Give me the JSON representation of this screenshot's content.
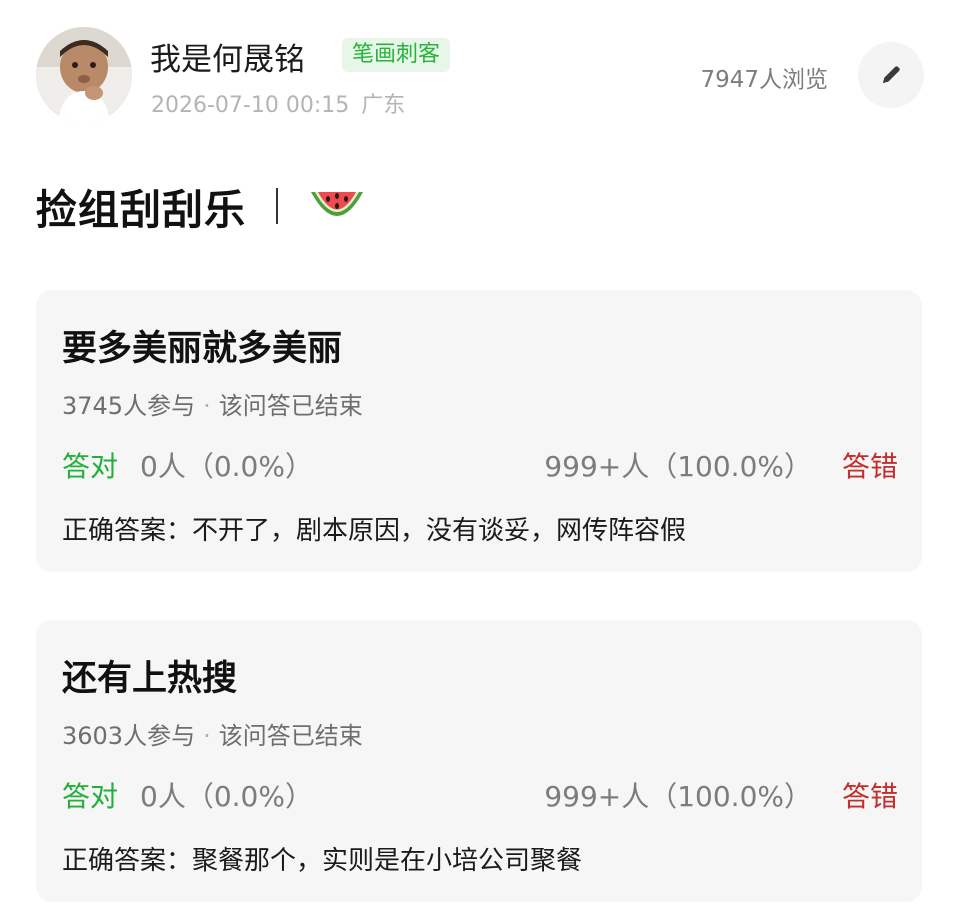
{
  "post": {
    "author": {
      "name": "我是何晟铭",
      "tag": "笔画刺客"
    },
    "timestamp": "2026-07-10 00:15",
    "location": "广东",
    "views": "7947人浏览",
    "title": "捡组刮刮乐",
    "title_emoji": "🍉",
    "icons": {
      "avatar": "avatar-photo",
      "edit": "pencil-icon",
      "emoji": "watermelon-icon"
    }
  },
  "quizzes": [
    {
      "question": "要多美丽就多美丽",
      "participants": "3745人参与",
      "status": "该问答已结束",
      "right_label": "答对",
      "right_count": "0人（0.0%）",
      "wrong_count": "999+人（100.0%）",
      "wrong_label": "答错",
      "answer": "正确答案：不开了，剧本原因，没有谈妥，网传阵容假"
    },
    {
      "question": "还有上热搜",
      "participants": "3603人参与",
      "status": "该问答已结束",
      "right_label": "答对",
      "right_count": "0人（0.0%）",
      "wrong_count": "999+人（100.0%）",
      "wrong_label": "答错",
      "answer": "正确答案：聚餐那个，实则是在小培公司聚餐"
    }
  ],
  "colors": {
    "right": "#21b03a",
    "wrong": "#c62c2c",
    "tag_bg": "#e7f6e8",
    "card_bg": "#f6f6f6"
  }
}
